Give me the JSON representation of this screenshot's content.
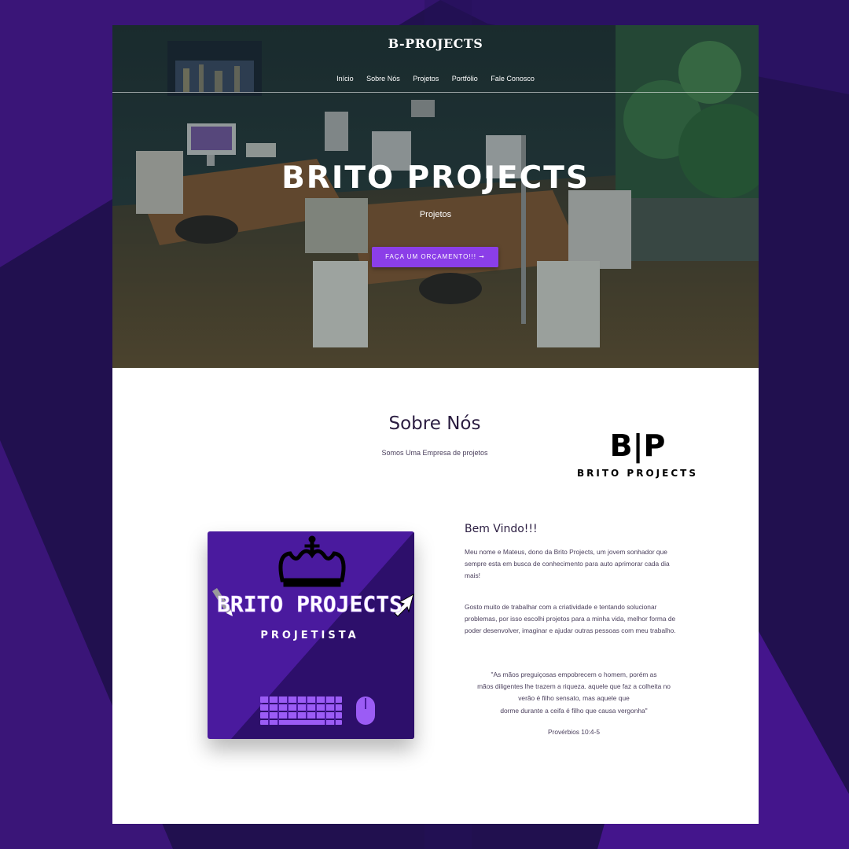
{
  "header": {
    "logo": "B-PROJECTS",
    "nav": [
      "Início",
      "Sobre Nós",
      "Projetos",
      "Portfólio",
      "Fale Conosco"
    ]
  },
  "hero": {
    "title": "BRITO PROJECTS",
    "subtitle": "Projetos",
    "cta_label": "FAÇA UM ORÇAMENTO!!! ➞"
  },
  "about": {
    "title": "Sobre Nós",
    "subtitle": "Somos Uma Empresa de projetos",
    "logo_letters": "B|P",
    "logo_wordmark": "BRITO PROJECTS"
  },
  "card": {
    "title": "BRITO PROJECTS",
    "subtitle": "PROJETISTA"
  },
  "welcome": {
    "title": "Bem Vindo!!!",
    "paragraph1": "Meu nome e Mateus, dono da Brito Projects, um jovem sonhador que sempre esta em busca de conhecimento para auto aprimorar cada dia mais!",
    "paragraph2": "Gosto muito de trabalhar com a criatividade e tentando solucionar problemas, por isso escolhi projetos para a minha vida, melhor forma de poder desenvolver, imaginar e ajudar outras pessoas com meu trabalho.",
    "quote_lines": [
      "\"As mãos preguiçosas empobrecem o homem, porém as",
      "mãos diligentes lhe trazem a riqueza. aquele que faz a colheita no",
      "verão é filho sensato, mas aquele que",
      "dorme durante a ceifa é filho que causa vergonha\""
    ],
    "quote_ref": "Provérbios 10:4-5"
  },
  "colors": {
    "background": "#21104f",
    "accent": "#8b3ee8",
    "card_purple": "#4a1a9e",
    "text_dark": "#2a1c40"
  }
}
